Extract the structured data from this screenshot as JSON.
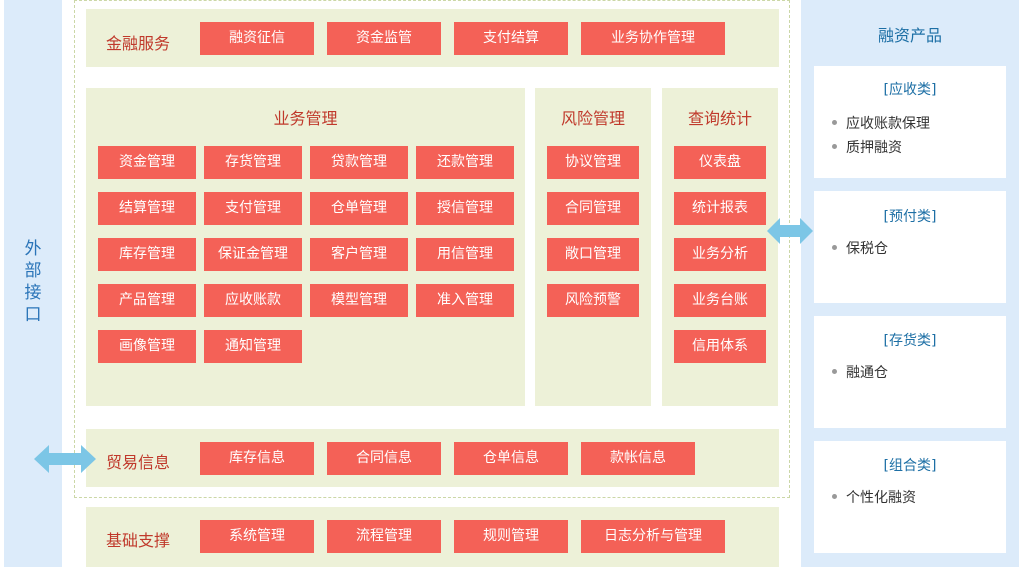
{
  "external_interface": {
    "label": "外部接口"
  },
  "sections": {
    "finance": {
      "title": "金融服务",
      "items": [
        "融资征信",
        "资金监管",
        "支付结算",
        "业务协作管理"
      ]
    },
    "business": {
      "title": "业务管理",
      "items": [
        "资金管理",
        "存货管理",
        "贷款管理",
        "还款管理",
        "结算管理",
        "支付管理",
        "仓单管理",
        "授信管理",
        "库存管理",
        "保证金管理",
        "客户管理",
        "用信管理",
        "产品管理",
        "应收账款",
        "模型管理",
        "准入管理",
        "画像管理",
        "通知管理"
      ]
    },
    "risk": {
      "title": "风险管理",
      "items": [
        "协议管理",
        "合同管理",
        "敞口管理",
        "风险预警"
      ]
    },
    "query": {
      "title": "查询统计",
      "items": [
        "仪表盘",
        "统计报表",
        "业务分析",
        "业务台账",
        "信用体系"
      ]
    },
    "trade": {
      "title": "贸易信息",
      "items": [
        "库存信息",
        "合同信息",
        "仓单信息",
        "款帐信息"
      ]
    },
    "infra": {
      "title": "基础支撑",
      "items": [
        "系统管理",
        "流程管理",
        "规则管理",
        "日志分析与管理"
      ]
    }
  },
  "products": {
    "title": "融资产品",
    "cards": [
      {
        "title": "[应收类]",
        "items": [
          "应收账款保理",
          "质押融资"
        ]
      },
      {
        "title": "[预付类]",
        "items": [
          "保税仓"
        ]
      },
      {
        "title": "[存货类]",
        "items": [
          "融通仓"
        ]
      },
      {
        "title": "[组合类]",
        "items": [
          "个性化融资"
        ]
      }
    ]
  },
  "colors": {
    "accent": "#f46157",
    "panel": "#edf1d8",
    "side": "#dcebfa",
    "arrow": "#7cc6e6",
    "title_red": "#c0392b",
    "title_blue": "#1d6fa5"
  }
}
